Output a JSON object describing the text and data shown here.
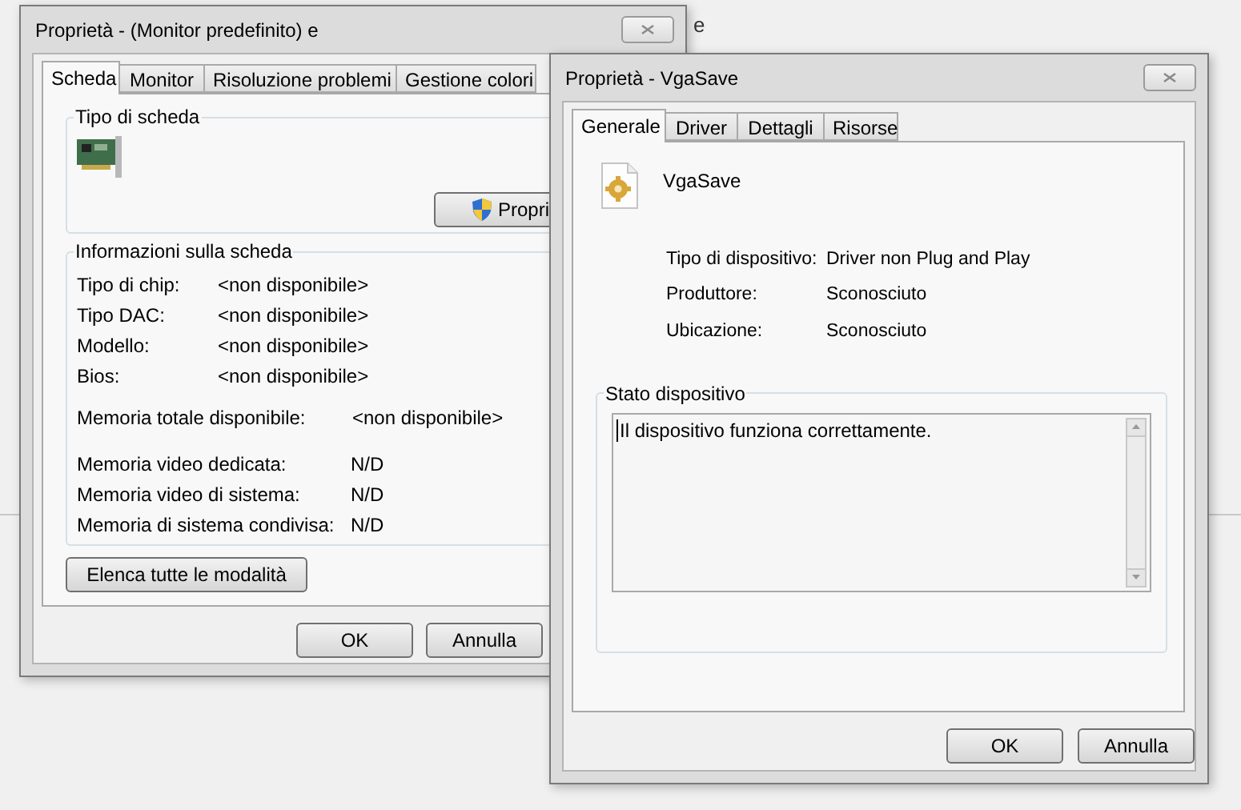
{
  "background_fragment": "e",
  "windows": [
    {
      "title": "Proprietà - (Monitor predefinito) e",
      "tabs": [
        {
          "label": "Scheda",
          "selected": true
        },
        {
          "label": "Monitor",
          "selected": false
        },
        {
          "label": "Risoluzione problemi",
          "selected": false
        },
        {
          "label": "Gestione colori",
          "selected": false
        }
      ],
      "adapter_group": {
        "title": "Tipo di scheda",
        "button": "Propri"
      },
      "info_group": {
        "title": "Informazioni sulla scheda",
        "sections": [
          [
            {
              "label": "Tipo di chip:",
              "value": "<non disponibile>"
            },
            {
              "label": "Tipo DAC:",
              "value": "<non disponibile>"
            },
            {
              "label": "Modello:",
              "value": "<non disponibile>"
            },
            {
              "label": "Bios:",
              "value": "<non disponibile>"
            }
          ],
          [
            {
              "label": "Memoria totale disponibile:",
              "value": "<non disponibile>"
            }
          ],
          [
            {
              "label": "Memoria video dedicata:",
              "value": "N/D"
            },
            {
              "label": "Memoria video di sistema:",
              "value": "N/D"
            },
            {
              "label": "Memoria di sistema condivisa:",
              "value": "N/D"
            }
          ]
        ]
      },
      "list_modes_button": "Elenca tutte le modalità",
      "buttons": [
        "OK",
        "Annulla"
      ]
    },
    {
      "title": "Proprietà - VgaSave",
      "tabs": [
        {
          "label": "Generale",
          "selected": true
        },
        {
          "label": "Driver",
          "selected": false
        },
        {
          "label": "Dettagli",
          "selected": false
        },
        {
          "label": "Risorse",
          "selected": false
        }
      ],
      "device_name": "VgaSave",
      "properties": [
        {
          "label": "Tipo di dispositivo:",
          "value": "Driver non Plug and Play"
        },
        {
          "label": "Produttore:",
          "value": "Sconosciuto"
        },
        {
          "label": "Ubicazione:",
          "value": "Sconosciuto"
        }
      ],
      "status_group": {
        "title": "Stato dispositivo",
        "text": "Il dispositivo funziona correttamente."
      },
      "buttons": [
        "OK",
        "Annulla"
      ]
    }
  ]
}
